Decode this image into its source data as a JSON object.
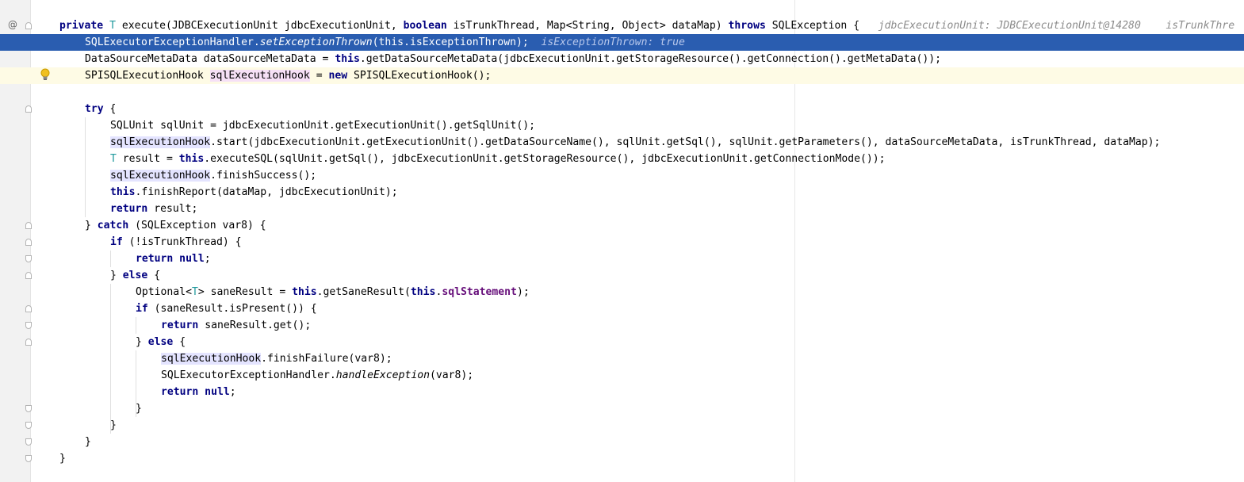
{
  "gutter": {
    "override_marker": "@"
  },
  "lines": [
    {
      "id": "l1",
      "tokens": [
        {
          "t": "private ",
          "c": "kw"
        },
        {
          "t": "T",
          "c": "tp"
        },
        {
          "t": " execute(JDBCExecutionUnit jdbcExecutionUnit, "
        },
        {
          "t": "boolean ",
          "c": "kw"
        },
        {
          "t": "isTrunkThread, Map<String, Object> dataMap) "
        },
        {
          "t": "throws ",
          "c": "kw"
        },
        {
          "t": "SQLException {   "
        },
        {
          "t": "jdbcExecutionUnit: JDBCExecutionUnit@14280    isTrunkThre",
          "c": "hint"
        }
      ]
    },
    {
      "id": "l2",
      "tokens": [
        {
          "t": "SQLExecutorExceptionHandler."
        },
        {
          "t": "setExceptionThrown",
          "c": "it"
        },
        {
          "t": "("
        },
        {
          "t": "this",
          "c": "kw"
        },
        {
          "t": "."
        },
        {
          "t": "isExceptionThrown",
          "c": "fld"
        },
        {
          "t": ");  "
        },
        {
          "t": "isExceptionThrown: true",
          "c": "hint"
        }
      ]
    },
    {
      "id": "l3",
      "tokens": [
        {
          "t": "DataSourceMetaData dataSourceMetaData = "
        },
        {
          "t": "this",
          "c": "kw"
        },
        {
          "t": ".getDataSourceMetaData(jdbcExecutionUnit.getStorageResource().getConnection().getMetaData());"
        }
      ]
    },
    {
      "id": "l4",
      "tokens": [
        {
          "t": "SPISQLExecutionHook "
        },
        {
          "t": "sqlExecutionHook",
          "c": "hlw"
        },
        {
          "t": " = "
        },
        {
          "t": "new ",
          "c": "kw"
        },
        {
          "t": "SPISQLExecutionHook();"
        }
      ]
    },
    {
      "id": "l5",
      "tokens": []
    },
    {
      "id": "l6",
      "tokens": [
        {
          "t": "try ",
          "c": "kw"
        },
        {
          "t": "{"
        }
      ]
    },
    {
      "id": "l7",
      "tokens": [
        {
          "t": "SQLUnit sqlUnit = jdbcExecutionUnit.getExecutionUnit().getSqlUnit();"
        }
      ]
    },
    {
      "id": "l8",
      "tokens": [
        {
          "t": "sqlExecutionHook",
          "c": "hl"
        },
        {
          "t": ".start(jdbcExecutionUnit.getExecutionUnit().getDataSourceName(), sqlUnit.getSql(), sqlUnit.getParameters(), dataSourceMetaData, isTrunkThread, dataMap);"
        }
      ]
    },
    {
      "id": "l9",
      "tokens": [
        {
          "t": "T",
          "c": "tp"
        },
        {
          "t": " result = "
        },
        {
          "t": "this",
          "c": "kw"
        },
        {
          "t": ".executeSQL(sqlUnit.getSql(), jdbcExecutionUnit.getStorageResource(), jdbcExecutionUnit.getConnectionMode());"
        }
      ]
    },
    {
      "id": "l10",
      "tokens": [
        {
          "t": "sqlExecutionHook",
          "c": "hl"
        },
        {
          "t": ".finishSuccess();"
        }
      ]
    },
    {
      "id": "l11",
      "tokens": [
        {
          "t": "this",
          "c": "kw"
        },
        {
          "t": ".finishReport(dataMap, jdbcExecutionUnit);"
        }
      ]
    },
    {
      "id": "l12",
      "tokens": [
        {
          "t": "return ",
          "c": "kw"
        },
        {
          "t": "result;"
        }
      ]
    },
    {
      "id": "l13",
      "tokens": [
        {
          "t": "} "
        },
        {
          "t": "catch ",
          "c": "kw"
        },
        {
          "t": "(SQLException var8) {"
        }
      ]
    },
    {
      "id": "l14",
      "tokens": [
        {
          "t": "if ",
          "c": "kw"
        },
        {
          "t": "(!isTrunkThread) {"
        }
      ]
    },
    {
      "id": "l15",
      "tokens": [
        {
          "t": "return null",
          "c": "kw"
        },
        {
          "t": ";"
        }
      ]
    },
    {
      "id": "l16",
      "tokens": [
        {
          "t": "} "
        },
        {
          "t": "else ",
          "c": "kw"
        },
        {
          "t": "{"
        }
      ]
    },
    {
      "id": "l17",
      "tokens": [
        {
          "t": "Optional<"
        },
        {
          "t": "T",
          "c": "tp"
        },
        {
          "t": "> saneResult = "
        },
        {
          "t": "this",
          "c": "kw"
        },
        {
          "t": ".getSaneResult("
        },
        {
          "t": "this",
          "c": "kw"
        },
        {
          "t": "."
        },
        {
          "t": "sqlStatement",
          "c": "fld"
        },
        {
          "t": ");"
        }
      ]
    },
    {
      "id": "l18",
      "tokens": [
        {
          "t": "if ",
          "c": "kw"
        },
        {
          "t": "(saneResult.isPresent()) {"
        }
      ]
    },
    {
      "id": "l19",
      "tokens": [
        {
          "t": "return ",
          "c": "kw"
        },
        {
          "t": "saneResult.get();"
        }
      ]
    },
    {
      "id": "l20",
      "tokens": [
        {
          "t": "} "
        },
        {
          "t": "else ",
          "c": "kw"
        },
        {
          "t": "{"
        }
      ]
    },
    {
      "id": "l21",
      "tokens": [
        {
          "t": "sqlExecutionHook",
          "c": "hl"
        },
        {
          "t": ".finishFailure(var8);"
        }
      ]
    },
    {
      "id": "l22",
      "tokens": [
        {
          "t": "SQLExecutorExceptionHandler."
        },
        {
          "t": "handleException",
          "c": "it"
        },
        {
          "t": "(var8);"
        }
      ]
    },
    {
      "id": "l23",
      "tokens": [
        {
          "t": "return null",
          "c": "kw"
        },
        {
          "t": ";"
        }
      ]
    },
    {
      "id": "l24",
      "tokens": [
        {
          "t": "}"
        }
      ]
    },
    {
      "id": "l25",
      "tokens": [
        {
          "t": "}"
        }
      ]
    },
    {
      "id": "l26",
      "tokens": [
        {
          "t": "}"
        }
      ]
    },
    {
      "id": "l27",
      "tokens": [
        {
          "t": "}"
        }
      ]
    }
  ],
  "colors": {
    "keyword": "#000080",
    "type_param": "#20999d",
    "field": "#660e7a",
    "execution_line": "#2a5db0",
    "caret_line": "#fefbe5",
    "usage_highlight": "#e4e4ff",
    "write_highlight": "#f6e0f6"
  }
}
